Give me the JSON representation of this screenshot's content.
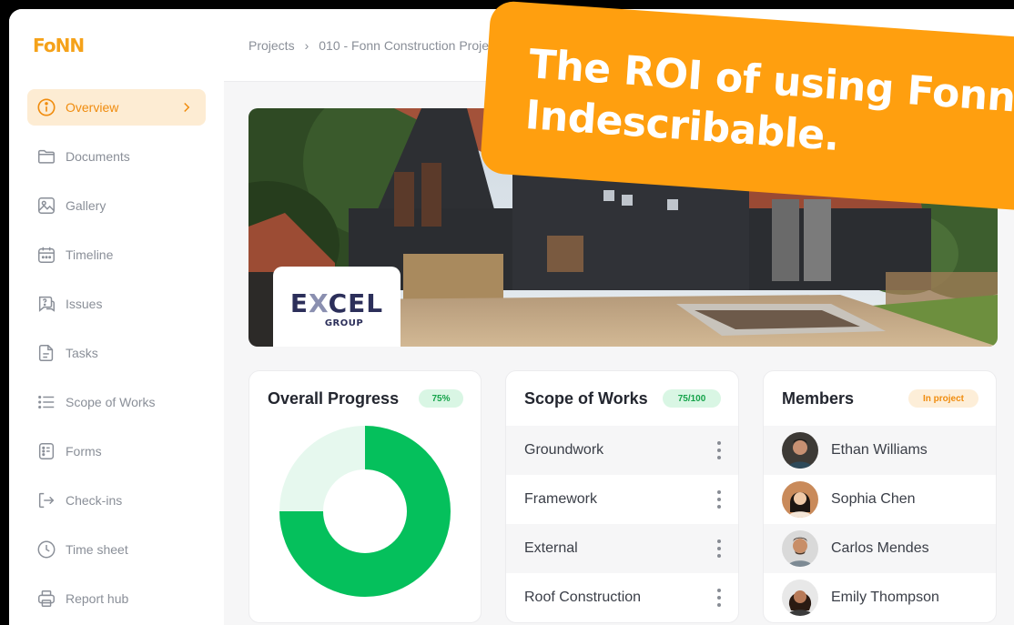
{
  "app": {
    "logo_text": "FoNN"
  },
  "sidebar": {
    "items": [
      {
        "label": "Overview",
        "icon": "info-icon",
        "active": true
      },
      {
        "label": "Documents",
        "icon": "folder-icon"
      },
      {
        "label": "Gallery",
        "icon": "image-icon"
      },
      {
        "label": "Timeline",
        "icon": "calendar-icon"
      },
      {
        "label": "Issues",
        "icon": "chat-question-icon"
      },
      {
        "label": "Tasks",
        "icon": "file-icon"
      },
      {
        "label": "Scope of Works",
        "icon": "list-icon"
      },
      {
        "label": "Forms",
        "icon": "form-icon"
      },
      {
        "label": "Check-ins",
        "icon": "sign-in-icon"
      },
      {
        "label": "Time sheet",
        "icon": "clock-icon"
      },
      {
        "label": "Report hub",
        "icon": "printer-icon"
      }
    ]
  },
  "breadcrumb": {
    "root": "Projects",
    "current": "010 - Fonn Construction Proje"
  },
  "hero": {
    "logo_main_a": "E",
    "logo_main_x": "X",
    "logo_main_b": "CEL",
    "logo_sub": "GROUP"
  },
  "progress": {
    "title": "Overall Progress",
    "badge": "75%",
    "value": 0.75
  },
  "scope": {
    "title": "Scope of  Works",
    "badge": "75/100",
    "items": [
      "Groundwork",
      "Framework",
      "External",
      "Roof Construction"
    ]
  },
  "members": {
    "title": "Members",
    "badge": "In project",
    "people": [
      "Ethan Williams",
      "Sophia Chen",
      "Carlos Mendes",
      "Emily Thompson"
    ]
  },
  "banner": {
    "line1": "The ROI of using Fonn",
    "line2": "Indescribable."
  },
  "colors": {
    "accent": "#ff9f0f",
    "green": "#05c05c",
    "green_light": "#e6f8ee"
  }
}
